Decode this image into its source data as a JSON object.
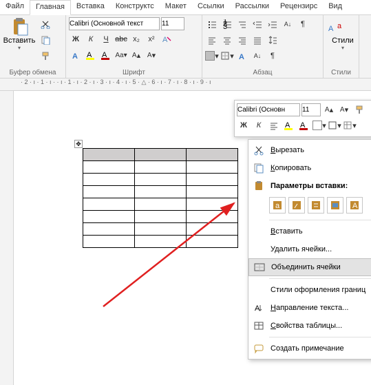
{
  "tabs": {
    "file": "Файл",
    "home": "Главная",
    "insert": "Вставка",
    "design": "Конструктс",
    "layout": "Макет",
    "references": "Ссылки",
    "mailings": "Рассылки",
    "review": "Рецензирс",
    "view": "Вид"
  },
  "ribbon": {
    "clipboard": {
      "label": "Буфер обмена",
      "paste": "Вставить"
    },
    "font": {
      "label": "Шрифт",
      "name": "Calibri (Основной текст",
      "size": "11",
      "bold": "Ж",
      "italic": "К",
      "underline": "Ч",
      "strike": "abc",
      "sub": "x₂",
      "sup": "x²"
    },
    "paragraph": {
      "label": "Абзац"
    },
    "styles": {
      "label": "Стили",
      "btn": "Стили"
    }
  },
  "ruler": "· 2 · ı · 1 · ı ·    · ı · 1 · ı · 2 · ı · 3 · ı · 4 · ı · 5 · △ · 6 · ı · 7 · ı · 8 · ı · 9 · ı",
  "mini": {
    "font": "Calibri (Основн",
    "size": "11",
    "bold": "Ж",
    "italic": "К"
  },
  "context": {
    "cut": "Вырезать",
    "copy": "Копировать",
    "paste_options": "Параметры вставки:",
    "insert": "Вставить",
    "delete_cells": "Удалить ячейки...",
    "merge_cells": "Объединить ячейки",
    "border_styles": "Стили оформления границ",
    "text_direction": "Направление текста...",
    "table_properties": "Свойства таблицы...",
    "new_comment": "Создать примечание"
  }
}
